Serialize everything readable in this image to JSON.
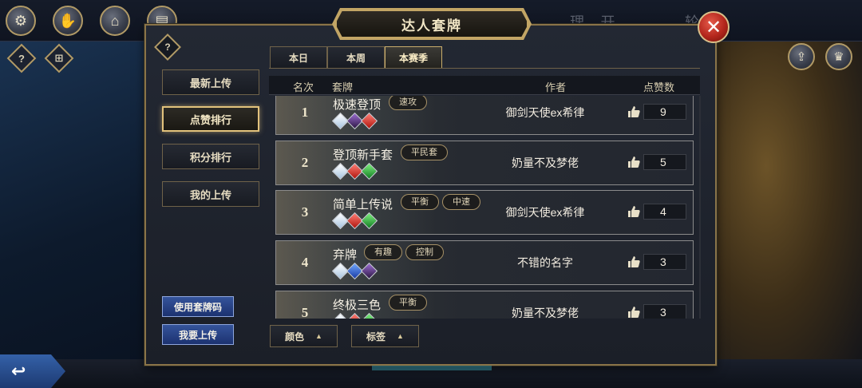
{
  "title": "达人套牌",
  "top_bar": {
    "faint_left": "理 开",
    "faint_right": "轮"
  },
  "icons": {
    "settings": "gear-icon",
    "handshake": "handshake-icon",
    "home": "home-icon",
    "cards": "cards-icon",
    "help": "help-icon",
    "gift": "gift-icon",
    "share": "share-icon",
    "trophy": "trophy-icon",
    "close": "close-icon",
    "back": "back-arrow-icon",
    "thumb": "thumbs-up-icon"
  },
  "side_menu": [
    {
      "label": "最新上传",
      "active": false
    },
    {
      "label": "点赞排行",
      "active": true
    },
    {
      "label": "积分排行",
      "active": false
    },
    {
      "label": "我的上传",
      "active": false
    }
  ],
  "bottom_actions": {
    "use_code": "使用套牌码",
    "upload": "我要上传"
  },
  "tabs": [
    {
      "label": "本日",
      "active": false
    },
    {
      "label": "本周",
      "active": false
    },
    {
      "label": "本赛季",
      "active": true
    }
  ],
  "columns": {
    "rank": "名次",
    "deck": "套牌",
    "author": "作者",
    "likes": "点赞数"
  },
  "rows": [
    {
      "rank": "1",
      "name": "极速登顶",
      "tags": [
        "速攻"
      ],
      "gems": [
        "white",
        "purple",
        "red"
      ],
      "author": "御剑天使ex希律",
      "likes": "9"
    },
    {
      "rank": "2",
      "name": "登顶新手套",
      "tags": [
        "平民套"
      ],
      "gems": [
        "white",
        "red",
        "green"
      ],
      "author": "奶量不及梦佬",
      "likes": "5"
    },
    {
      "rank": "3",
      "name": "简单上传说",
      "tags": [
        "平衡",
        "中速"
      ],
      "gems": [
        "white",
        "red",
        "green"
      ],
      "author": "御剑天使ex希律",
      "likes": "4"
    },
    {
      "rank": "4",
      "name": "弃牌",
      "tags": [
        "有趣",
        "控制"
      ],
      "gems": [
        "white",
        "blue",
        "purple"
      ],
      "author": "不错的名字",
      "likes": "3"
    },
    {
      "rank": "5",
      "name": "终极三色",
      "tags": [
        "平衡"
      ],
      "gems": [
        "white",
        "red",
        "green"
      ],
      "author": "奶量不及梦佬",
      "likes": "3"
    }
  ],
  "filters": {
    "color": "颜色",
    "tag": "标签"
  },
  "colors": {
    "gold_border": "#c2a565",
    "close_red": "#b3261c",
    "blue_button": "#1c3270"
  }
}
